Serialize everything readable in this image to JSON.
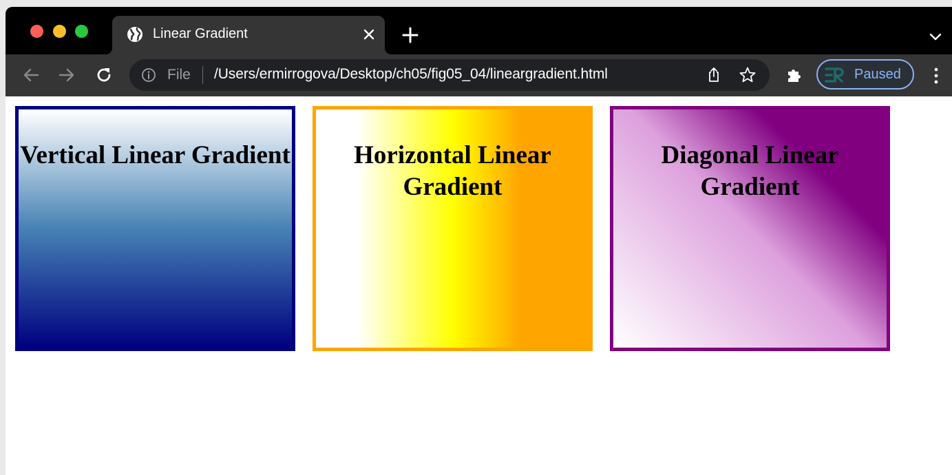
{
  "browser": {
    "tab": {
      "title": "Linear Gradient",
      "favicon": "globe-icon",
      "close_icon": "close-icon"
    },
    "new_tab_icon": "plus-icon",
    "tab_menu_icon": "chevron-down-icon",
    "toolbar": {
      "back_icon": "arrow-left-icon",
      "forward_icon": "arrow-right-icon",
      "reload_icon": "reload-icon",
      "omnibox": {
        "info_icon": "info-icon",
        "scheme_label": "File",
        "url": "/Users/ermirrogova/Desktop/ch05/fig05_04/lineargradient.html",
        "share_icon": "share-icon",
        "bookmark_icon": "star-icon"
      },
      "extensions_icon": "puzzle-icon",
      "profile": {
        "label": "Paused",
        "accent": "#8ab4f8"
      },
      "menu_icon": "kebab-icon"
    },
    "colors": {
      "frame": "#000000",
      "toolbar": "#353535",
      "omnibox": "#202124"
    }
  },
  "page": {
    "boxes": [
      {
        "heading": "Vertical Linear Gradient",
        "border_color": "#000080",
        "gradient": [
          "#ffffff",
          "#4682b4",
          "#000080"
        ]
      },
      {
        "heading": "Horizontal Linear Gradient",
        "border_color": "#ffa500",
        "gradient": [
          "#ffffff",
          "#ffff00",
          "#ffa500"
        ]
      },
      {
        "heading": "Diagonal Linear Gradient",
        "border_color": "#800080",
        "gradient": [
          "#ffffff",
          "#dda0dd",
          "#800080"
        ]
      }
    ]
  }
}
